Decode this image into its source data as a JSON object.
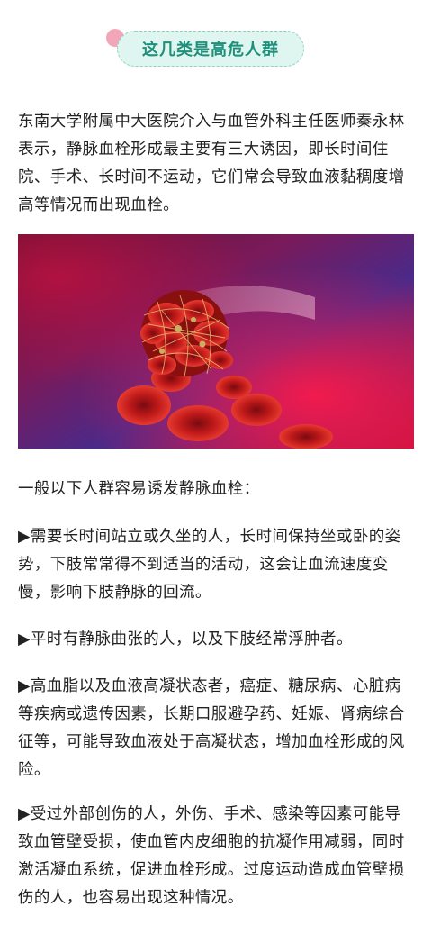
{
  "heading": {
    "title": "这几类是高危人群"
  },
  "intro": "东南大学附属中大医院介入与血管外科主任医师秦永林表示，静脉血栓形成最主要有三大诱因，即长时间住院、手术、长时间不运动，它们常会导致血液黏稠度增高等情况而出现血栓。",
  "image": {
    "description_icon": "blood-clot-illustration"
  },
  "lead": "一般以下人群容易诱发静脉血栓：",
  "items": [
    "▶需要长时间站立或久坐的人，长时间保持坐或卧的姿势，下肢常常得不到适当的活动，这会让血流速度变慢，影响下肢静脉的回流。",
    "▶平时有静脉曲张的人，以及下肢经常浮肿者。",
    "▶高血脂以及血液高凝状态者，癌症、糖尿病、心脏病等疾病或遗传因素，长期口服避孕药、妊娠、肾病综合征等，可能导致血液处于高凝状态，增加血栓形成的风险。",
    "▶受过外部创伤的人，外伤、手术、感染等因素可能导致血管壁受损，使血管内皮细胞的抗凝作用减弱，同时激活凝血系统，促进血栓形成。过度运动造成血管壁损伤的人，也容易出现这种情况。"
  ],
  "colors": {
    "heading_bg": "#dff5ef",
    "heading_text": "#1e8f7b",
    "heading_dot": "#f2a7b8"
  }
}
